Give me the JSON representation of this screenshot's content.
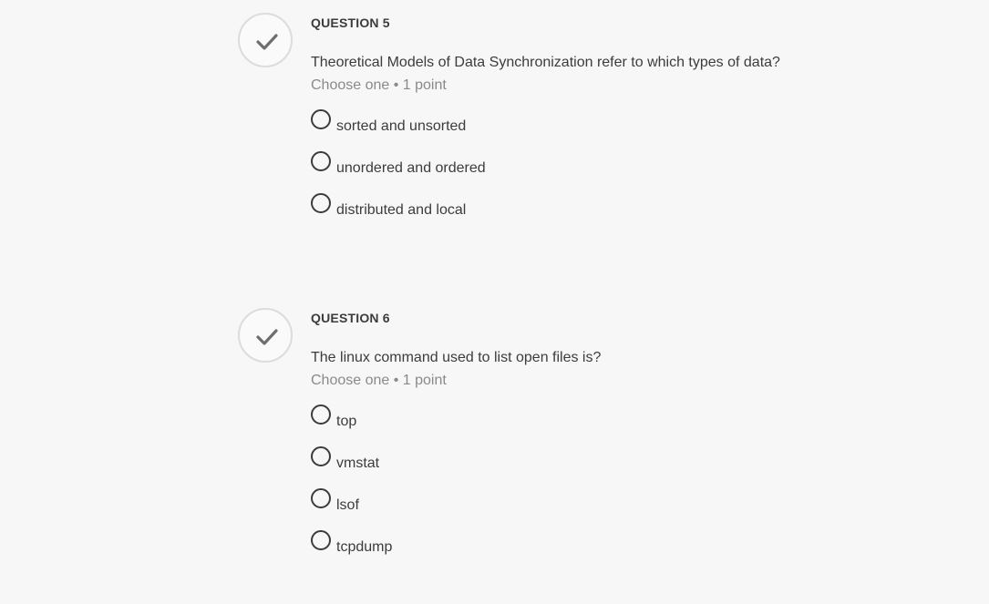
{
  "questions": [
    {
      "label": "QUESTION 5",
      "text": "Theoretical Models of Data Synchronization refer to which types of data?",
      "meta": "Choose one • 1 point",
      "status_icon": "checkmark-icon",
      "options": [
        "sorted and unsorted",
        "unordered and ordered",
        "distributed and local"
      ]
    },
    {
      "label": "QUESTION 6",
      "text": "The linux command used to list open files is?",
      "meta": "Choose one • 1 point",
      "status_icon": "checkmark-icon",
      "options": [
        "top",
        "vmstat",
        "lsof",
        "tcpdump"
      ]
    }
  ],
  "colors": {
    "background": "#f7f7f7",
    "text": "#3c3c3c",
    "muted": "#8a8a8a",
    "circle_border": "#dcdcdc",
    "check": "#6e6e6e"
  }
}
